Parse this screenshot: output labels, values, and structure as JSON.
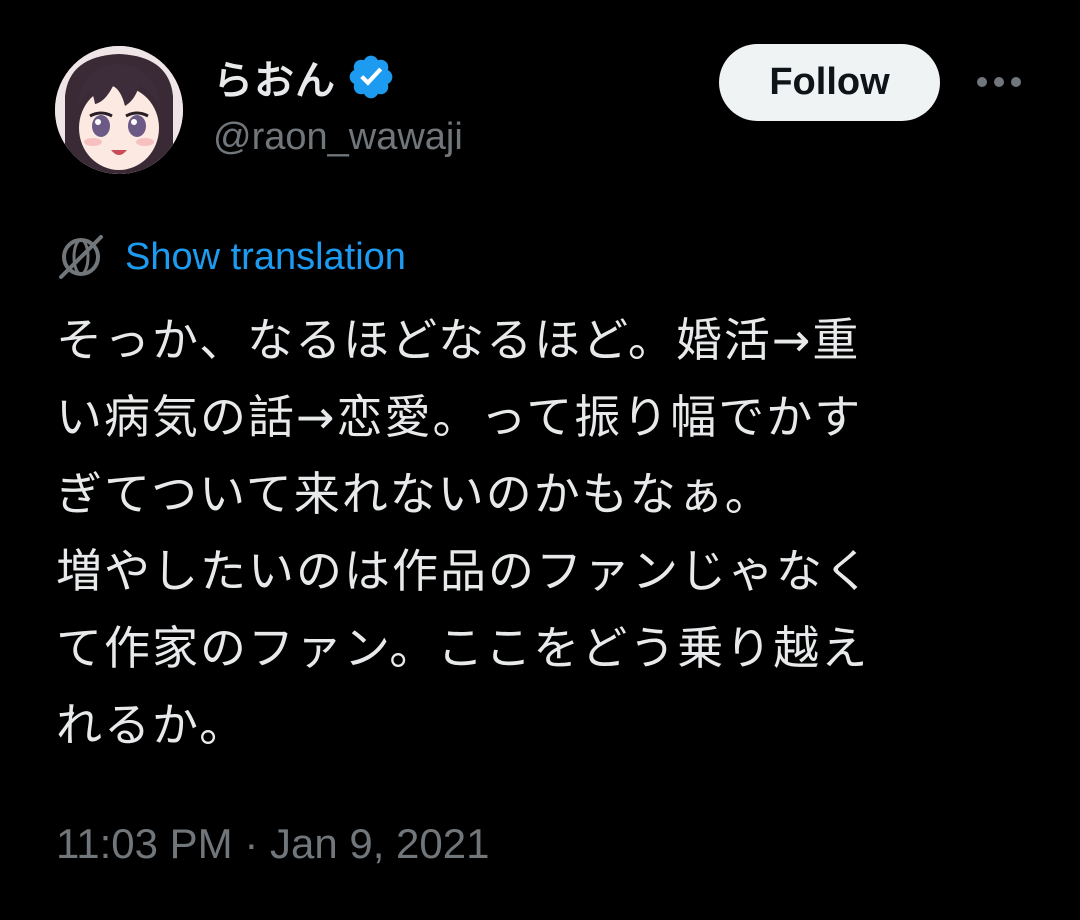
{
  "user": {
    "display_name": "らおん",
    "handle": "@raon_wawaji",
    "verified": true,
    "avatar": "anime-girl-avatar"
  },
  "actions": {
    "follow_label": "Follow",
    "more_icon": "more-horizontal-icon"
  },
  "translation": {
    "icon": "globe-icon",
    "label": "Show translation"
  },
  "tweet": {
    "lines": [
      "そっか、なるほどなるほど。婚活→重",
      "い病気の話→恋愛。って振り幅でかす",
      "ぎてついて来れないのかもなぁ。",
      "増やしたいのは作品のファンじゃなく",
      "て作家のファン。ここをどう乗り越え",
      "れるか。"
    ],
    "timestamp": "11:03 PM · Jan 9, 2021"
  },
  "colors": {
    "background": "#000000",
    "text": "#e7e9ea",
    "muted": "#71767b",
    "link": "#1d9bf0",
    "verified": "#1d9bf0",
    "follow_bg": "#eff3f4"
  }
}
